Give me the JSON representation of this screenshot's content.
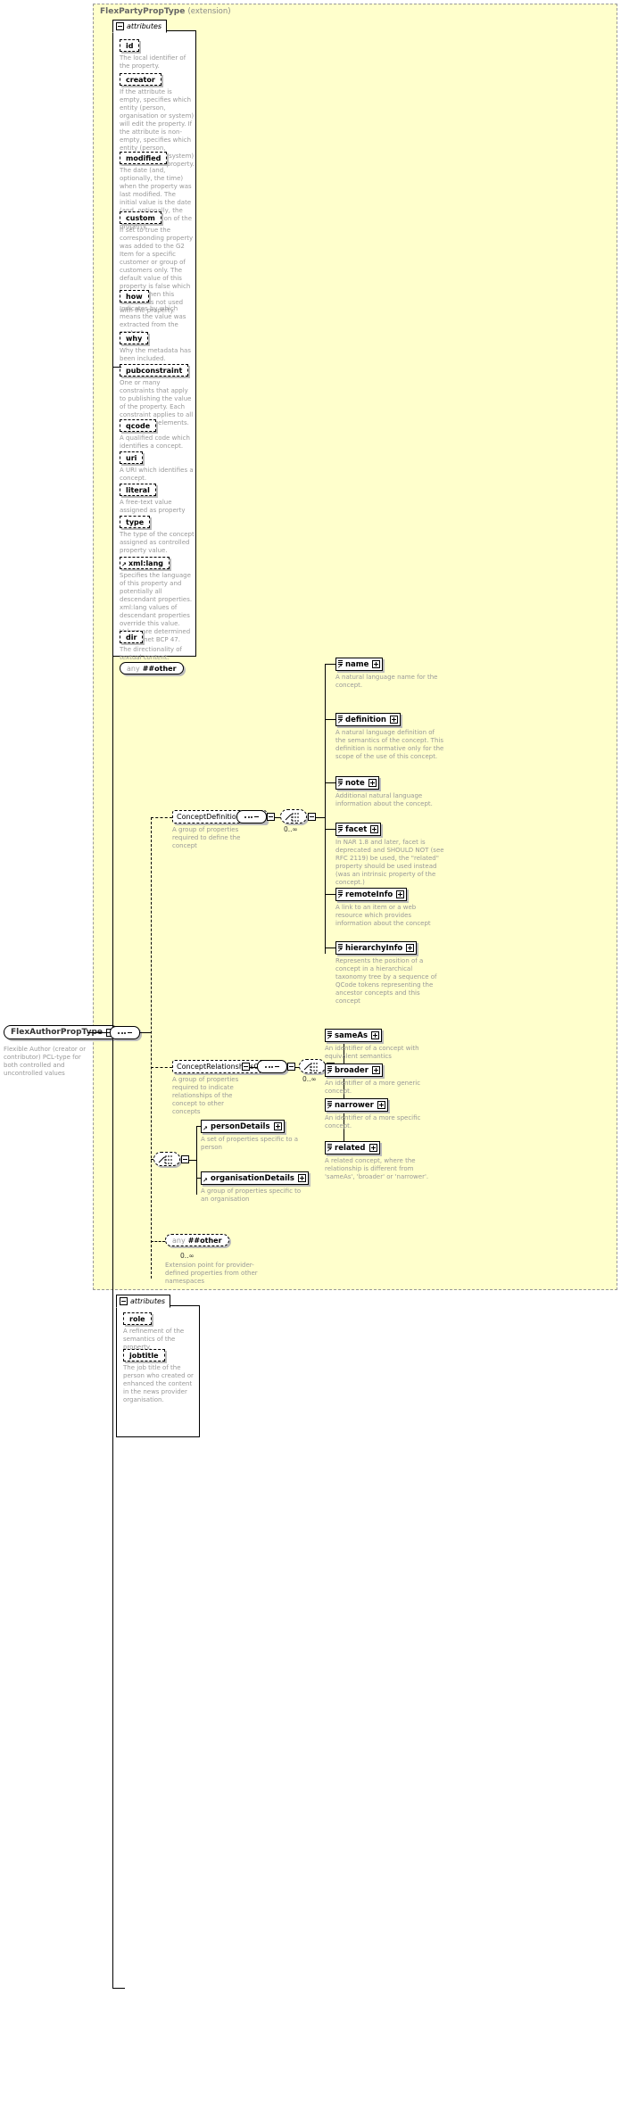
{
  "diagram": {
    "type": "xsd-schema-documentation",
    "extension_panel": {
      "title": "FlexPartyPropType",
      "qualifier": "(extension)"
    },
    "attributes_label": "attributes",
    "cardinality_unbounded": "0..∞"
  },
  "attributes_top": {
    "label": "attributes",
    "items": [
      {
        "name": "id",
        "desc": "The local identifier of the property."
      },
      {
        "name": "creator",
        "desc": "If the attribute is empty, specifies which entity (person, organisation or system) will edit the property. If the attribute is non-empty, specifies which entity (person, organisation or system) has edited the property."
      },
      {
        "name": "modified",
        "desc": "The date (and, optionally, the time) when the property was last modified. The initial value is the date (and, optionally, the time) of creation of the property."
      },
      {
        "name": "custom",
        "desc": "If set to true the corresponding property was added to the G2 Item for a specific customer or group of customers only. The default value of this property is false which applies when this attribute is not used with the property."
      },
      {
        "name": "how",
        "desc": "Indicates by which means the value was extracted from the content."
      },
      {
        "name": "why",
        "desc": "Why the metadata has been included."
      },
      {
        "name": "pubconstraint",
        "desc": "One or many constraints that apply to publishing the value of the property. Each constraint applies to all descendant elements."
      },
      {
        "name": "qcode",
        "desc": "A qualified code which identifies a concept."
      },
      {
        "name": "uri",
        "desc": "A URI which identifies a concept."
      },
      {
        "name": "literal",
        "desc": "A free-text value assigned as property value."
      },
      {
        "name": "type",
        "desc": "The type of the concept assigned as controlled property value."
      },
      {
        "name": "xml:lang",
        "desc": "Specifies the language of this property and potentially all descendant properties. xml:lang values of descendant properties override this value. Values are determined by Internet BCP 47."
      },
      {
        "name": "dir",
        "desc": "The directionality of textual content."
      }
    ],
    "any_label_prefix": "any",
    "any_label_name": "##other"
  },
  "type_box": {
    "name": "FlexAuthorPropType",
    "desc": "Flexible Author (creator or contributor) PCL-type for both controlled and uncontrolled values"
  },
  "concept_definition_group": {
    "name": "ConceptDefinitionGroup",
    "desc": "A group of properties required to define the concept",
    "cardinality": "0..∞",
    "elements": [
      {
        "name": "name",
        "desc": "A natural language name for the concept."
      },
      {
        "name": "definition",
        "desc": "A natural language definition of the semantics of the concept. This definition is normative only for the scope of the use of this concept."
      },
      {
        "name": "note",
        "desc": "Additional natural language information about the concept."
      },
      {
        "name": "facet",
        "desc": "In NAR 1.8 and later, facet is deprecated and SHOULD NOT (see RFC 2119) be used, the \"related\" property should be used instead (was an intrinsic property of the concept.)"
      },
      {
        "name": "remoteInfo",
        "desc": "A link to an item or a web resource which provides information about the concept"
      },
      {
        "name": "hierarchyInfo",
        "desc": "Represents the position of a concept in a hierarchical taxonomy tree by a sequence of QCode tokens representing the ancestor concepts and this concept"
      }
    ]
  },
  "concept_relationships_group": {
    "name": "ConceptRelationshipsGroup",
    "desc": "A group of properties required to indicate relationships of the concept to other concepts",
    "cardinality": "0..∞",
    "elements": [
      {
        "name": "sameAs",
        "desc": "An identifier of a concept with equivalent semantics"
      },
      {
        "name": "broader",
        "desc": "An identifier of a more generic concept."
      },
      {
        "name": "narrower",
        "desc": "An identifier of a more specific concept."
      },
      {
        "name": "related",
        "desc": "A related concept, where the relationship is different from 'sameAs', 'broader' or 'narrower'."
      }
    ]
  },
  "details_choice": {
    "elements": [
      {
        "name": "personDetails",
        "desc": "A set of properties specific to a person"
      },
      {
        "name": "organisationDetails",
        "desc": "A group of properties specific to an organisation"
      }
    ]
  },
  "extension_any": {
    "prefix": "any",
    "name": "##other",
    "cardinality": "0..∞",
    "desc": "Extension point for provider-defined properties from other namespaces"
  },
  "attributes_bottom": {
    "label": "attributes",
    "items": [
      {
        "name": "role",
        "desc": "A refinement of the semantics of the property."
      },
      {
        "name": "jobtitle",
        "desc": "The job title of the person who created or enhanced the content in the news provider organisation."
      }
    ]
  },
  "colors": {
    "extension_background": "#ffffcc",
    "description_text": "#999999",
    "border": "#000000",
    "shadow": "#bbbbbb"
  }
}
